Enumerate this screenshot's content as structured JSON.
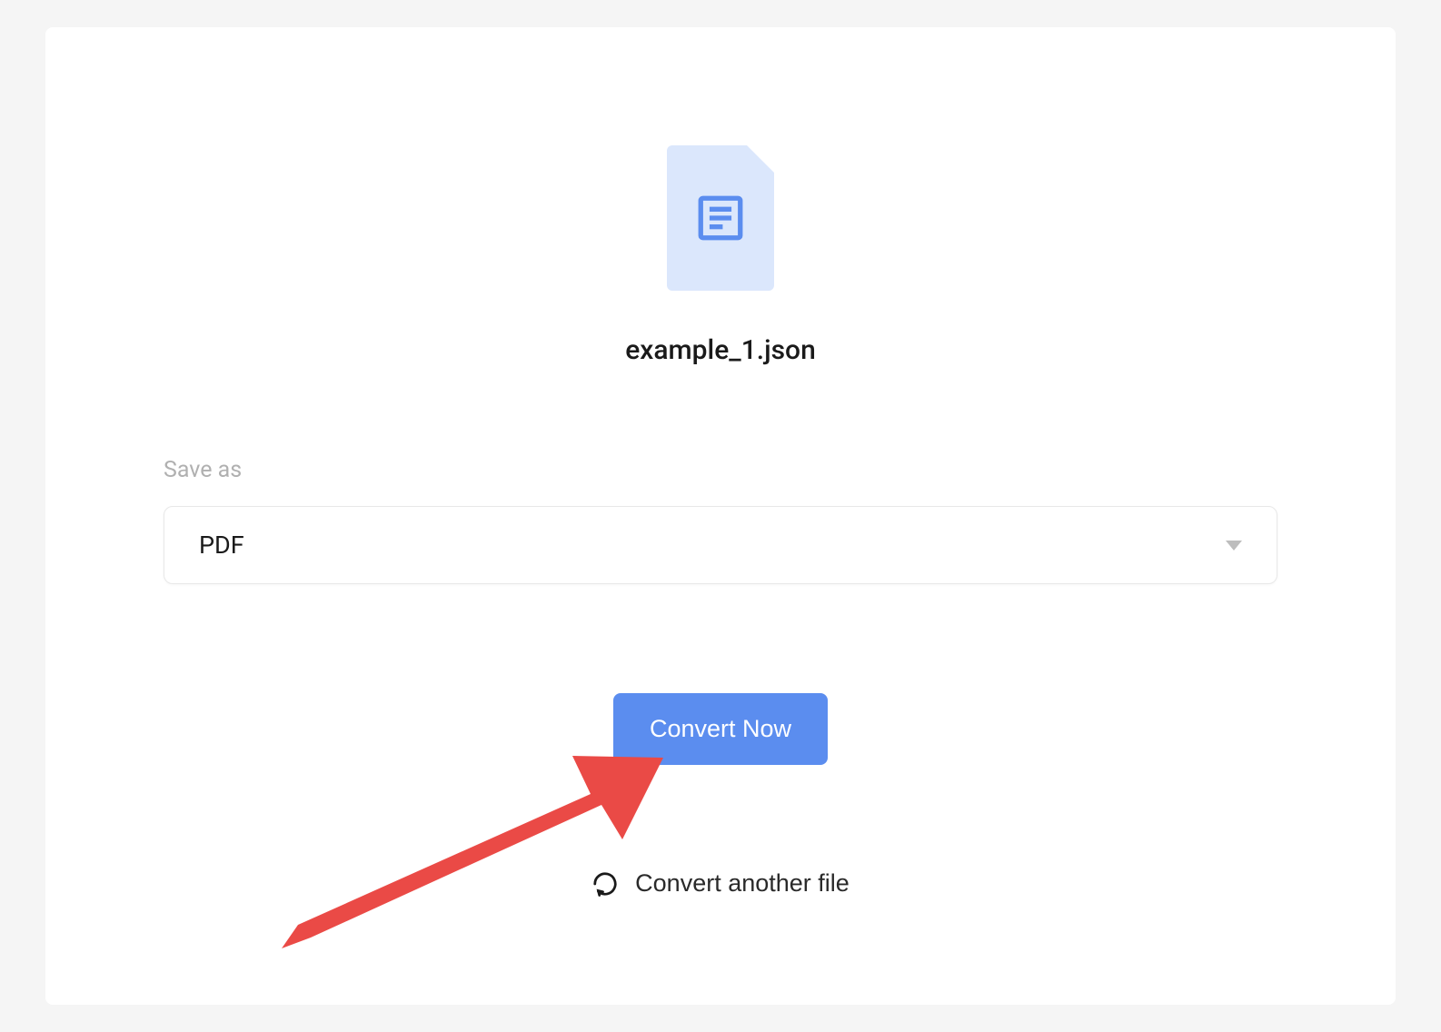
{
  "file": {
    "name": "example_1.json"
  },
  "form": {
    "save_as_label": "Save as",
    "format_selected": "PDF"
  },
  "actions": {
    "convert_label": "Convert Now",
    "convert_another_label": "Convert another file"
  }
}
